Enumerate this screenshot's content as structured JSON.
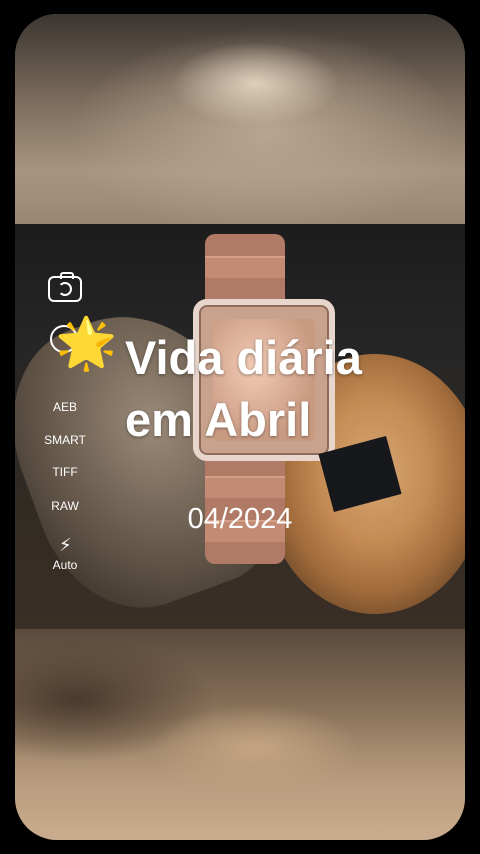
{
  "camera_tools": {
    "aeb": "AEB",
    "smart": "SMART",
    "tiff": "TIFF",
    "raw": "RAW",
    "flash_mode": "Auto"
  },
  "icons": {
    "camera_switch": "camera-switch-icon",
    "timer": "timer-icon",
    "flash": "flash-icon",
    "star": "star-emoji"
  },
  "overlay": {
    "star_emoji": "🌟",
    "title_line1": "Vida diária",
    "title_line2": "em Abril",
    "date": "04/2024"
  }
}
